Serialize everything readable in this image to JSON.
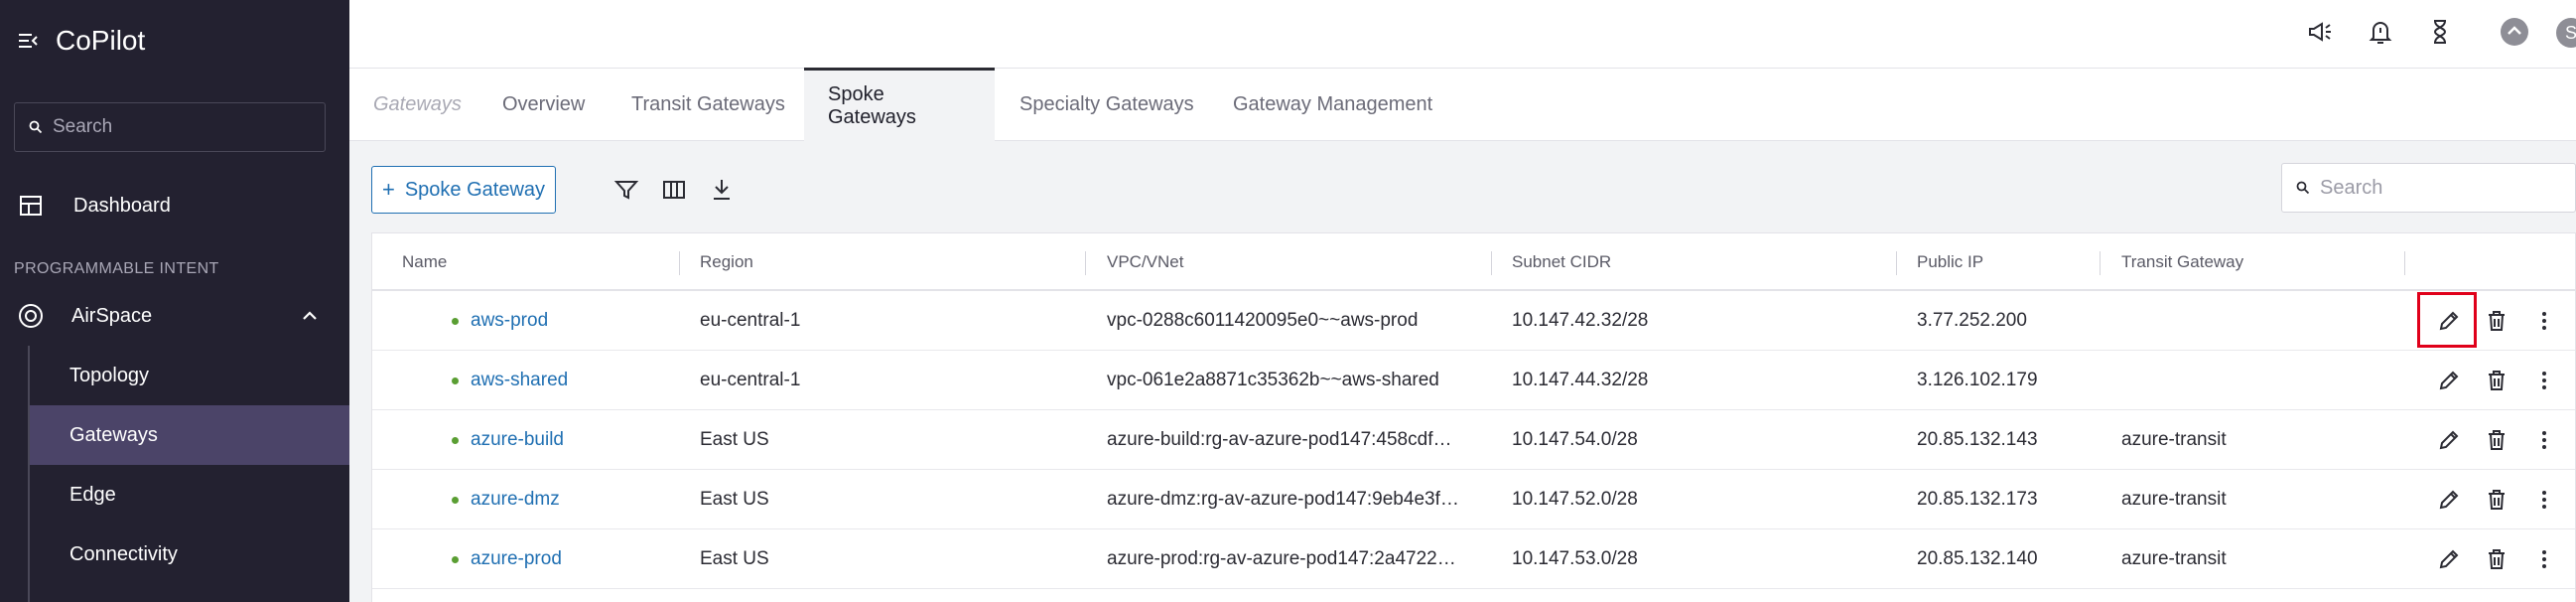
{
  "app": {
    "title": "CoPilot"
  },
  "sidebar": {
    "search_placeholder": "Search",
    "dashboard_label": "Dashboard",
    "section_label": "PROGRAMMABLE INTENT",
    "group_label": "AirSpace",
    "items": [
      {
        "label": "Topology"
      },
      {
        "label": "Gateways"
      },
      {
        "label": "Edge"
      },
      {
        "label": "Connectivity"
      }
    ]
  },
  "topbar": {
    "icons": [
      "megaphone-icon",
      "notifications-icon",
      "hourglass-icon",
      "upload-icon"
    ],
    "avatar_letter": "S"
  },
  "tabs": [
    {
      "label": "Gateways"
    },
    {
      "label": "Overview"
    },
    {
      "label": "Transit Gateways"
    },
    {
      "label": "Spoke Gateways"
    },
    {
      "label": "Specialty Gateways"
    },
    {
      "label": "Gateway Management"
    }
  ],
  "toolbar": {
    "add_label": "Spoke Gateway",
    "search_placeholder": "Search"
  },
  "table": {
    "columns": [
      "Name",
      "Region",
      "VPC/VNet",
      "Subnet CIDR",
      "Public IP",
      "Transit Gateway"
    ],
    "rows": [
      {
        "name": "aws-prod",
        "region": "eu-central-1",
        "vpc": "vpc-0288c6011420095e0~~aws-prod",
        "subnet": "10.147.42.32/28",
        "ip": "3.77.252.200",
        "transit": ""
      },
      {
        "name": "aws-shared",
        "region": "eu-central-1",
        "vpc": "vpc-061e2a8871c35362b~~aws-shared",
        "subnet": "10.147.44.32/28",
        "ip": "3.126.102.179",
        "transit": ""
      },
      {
        "name": "azure-build",
        "region": "East US",
        "vpc": "azure-build:rg-av-azure-pod147:458cdf…",
        "subnet": "10.147.54.0/28",
        "ip": "20.85.132.143",
        "transit": "azure-transit"
      },
      {
        "name": "azure-dmz",
        "region": "East US",
        "vpc": "azure-dmz:rg-av-azure-pod147:9eb4e3f…",
        "subnet": "10.147.52.0/28",
        "ip": "20.85.132.173",
        "transit": "azure-transit"
      },
      {
        "name": "azure-prod",
        "region": "East US",
        "vpc": "azure-prod:rg-av-azure-pod147:2a4722…",
        "subnet": "10.147.53.0/28",
        "ip": "20.85.132.140",
        "transit": "azure-transit"
      }
    ]
  },
  "colors": {
    "sidebar_bg": "#232130",
    "active_item_bg": "#4b4468",
    "link": "#1f6fb2",
    "status_ok": "#5a9e33",
    "highlight": "#e0001a"
  }
}
